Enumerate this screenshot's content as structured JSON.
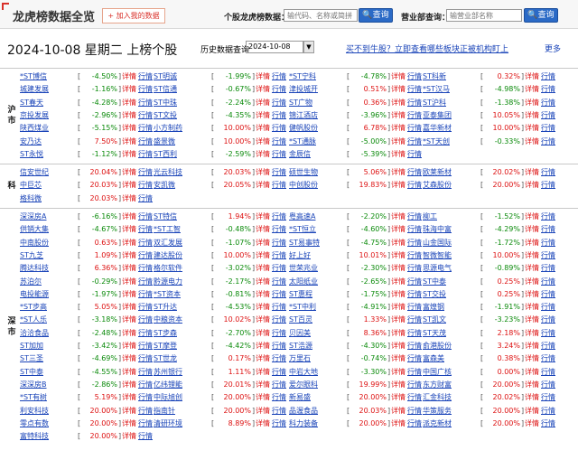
{
  "header": {
    "title": "龙虎榜数据全览",
    "fav_label": "+ 加入我的数据",
    "stock_label": "个股龙虎榜数据：",
    "stock_placeholder": "输代码、名称或简拼",
    "stock_button": "查询",
    "dept_label": "营业部查询：",
    "dept_placeholder": "输营业部名称",
    "dept_button": "查询"
  },
  "toolbar": {
    "date_title": "2024-10-08 星期二 上榜个股",
    "hist_label": "历史数据查询",
    "date_value": "2024-10-08",
    "promo_link": "买不到牛股？立即查看哪些板块正被机构盯上",
    "more_link": "更多"
  },
  "detail_label": "详情",
  "quote_label": "行情",
  "watermark": "",
  "sections": [
    {
      "label": "沪市",
      "rows": [
        [
          [
            "*ST博信",
            "-4.50%"
          ],
          [
            "ST明诚",
            "-1.99%"
          ],
          [
            "*ST宁科",
            "-4.78%"
          ],
          [
            "ST科新",
            "0.32%"
          ]
        ],
        [
          [
            "城建发展",
            "-1.16%"
          ],
          [
            "ST信通",
            "-0.67%"
          ],
          [
            "津投城开",
            "0.51%"
          ],
          [
            "*ST汉马",
            "-4.98%"
          ]
        ],
        [
          [
            "ST春天",
            "-4.28%"
          ],
          [
            "ST中珠",
            "-2.24%"
          ],
          [
            "ST广物",
            "0.36%"
          ],
          [
            "ST沪科",
            "-1.38%"
          ]
        ],
        [
          [
            "京投发展",
            "-2.96%"
          ],
          [
            "ST文投",
            "-4.35%"
          ],
          [
            "锦江酒店",
            "-3.96%"
          ],
          [
            "亚泰集团",
            "10.05%"
          ]
        ],
        [
          [
            "陕西煤业",
            "-5.15%"
          ],
          [
            "小方制药",
            "10.00%"
          ],
          [
            "健帆股份",
            "6.78%"
          ],
          [
            "嘉华新材",
            "10.00%"
          ]
        ],
        [
          [
            "安乃达",
            "7.50%"
          ],
          [
            "盛景微",
            "10.00%"
          ],
          [
            "*ST通脉",
            "-5.00%"
          ],
          [
            "*ST天创",
            "-0.33%"
          ]
        ],
        [
          [
            "ST永悦",
            "-1.12%"
          ],
          [
            "ST西利",
            "-2.59%"
          ],
          [
            "金辰信",
            "-5.39%"
          ],
          null
        ]
      ]
    },
    {
      "label": "科",
      "rows": [
        [
          [
            "信安世纪",
            "20.04%"
          ],
          [
            "光云科技",
            "20.03%"
          ],
          [
            "硕世生物",
            "5.06%"
          ],
          [
            "欧莱新材",
            "20.02%"
          ]
        ],
        [
          [
            "中巨芯",
            "20.03%"
          ],
          [
            "安凯微",
            "20.05%"
          ],
          [
            "中创股份",
            "19.83%"
          ],
          [
            "艾森股份",
            "20.00%"
          ]
        ],
        [
          [
            "格科微",
            "20.03%"
          ],
          null,
          null,
          null
        ]
      ]
    },
    {
      "label": "深市",
      "rows": [
        [
          [
            "深深房A",
            "-6.16%"
          ],
          [
            "ST特信",
            "1.94%"
          ],
          [
            "粤高速A",
            "-2.20%"
          ],
          [
            "柳工",
            "-1.52%"
          ]
        ],
        [
          [
            "供销大集",
            "-4.67%"
          ],
          [
            "*ST工智",
            "-0.48%"
          ],
          [
            "*ST恒立",
            "-4.60%"
          ],
          [
            "珠海中富",
            "-4.29%"
          ]
        ],
        [
          [
            "中南股份",
            "0.63%"
          ],
          [
            "双汇发展",
            "-1.07%"
          ],
          [
            "ST易事特",
            "-4.75%"
          ],
          [
            "山金国际",
            "-1.72%"
          ]
        ],
        [
          [
            "ST九芝",
            "1.09%"
          ],
          [
            "建达股份",
            "10.00%"
          ],
          [
            "好上好",
            "10.01%"
          ],
          [
            "智微智能",
            "10.00%"
          ]
        ],
        [
          [
            "腾达科技",
            "6.36%"
          ],
          [
            "格尔软件",
            "-3.02%"
          ],
          [
            "世荣兆业",
            "-2.30%"
          ],
          [
            "思源电气",
            "-0.89%"
          ]
        ],
        [
          [
            "苏泊尔",
            "-0.29%"
          ],
          [
            "黔源电力",
            "-2.17%"
          ],
          [
            "太阳纸业",
            "-2.65%"
          ],
          [
            "ST中泰",
            "0.25%"
          ]
        ],
        [
          [
            "电投能源",
            "-1.97%"
          ],
          [
            "*ST资本",
            "-0.81%"
          ],
          [
            "ST惠程",
            "-1.75%"
          ],
          [
            "ST交投",
            "0.25%"
          ]
        ],
        [
          [
            "*ST步高",
            "5.05%"
          ],
          [
            "ST升达",
            "-4.53%"
          ],
          [
            "*ST中利",
            "-4.91%"
          ],
          [
            "富煌钢",
            "-1.91%"
          ]
        ],
        [
          [
            "*ST人乐",
            "-3.18%"
          ],
          [
            "中粮资本",
            "10.02%"
          ],
          [
            "ST百灵",
            "1.33%"
          ],
          [
            "ST凯文",
            "-3.23%"
          ]
        ],
        [
          [
            "洽洽食品",
            "-2.48%"
          ],
          [
            "ST步森",
            "-2.70%"
          ],
          [
            "贝因美",
            "8.36%"
          ],
          [
            "ST天茂",
            "2.18%"
          ]
        ],
        [
          [
            "ST加加",
            "-3.42%"
          ],
          [
            "ST摩登",
            "-4.42%"
          ],
          [
            "ST浩源",
            "-4.30%"
          ],
          [
            "俞港股份",
            "3.24%"
          ]
        ],
        [
          [
            "ST三圣",
            "-4.69%"
          ],
          [
            "ST世龙",
            "0.17%"
          ],
          [
            "万里石",
            "-0.74%"
          ],
          [
            "富森美",
            "0.38%"
          ]
        ],
        [
          [
            "ST中泰",
            "-4.55%"
          ],
          [
            "苏州银行",
            "1.11%"
          ],
          [
            "中岩大地",
            "-3.30%"
          ],
          [
            "中国广核",
            "0.00%"
          ]
        ],
        [
          [
            "深深房B",
            "-2.86%"
          ],
          [
            "亿纬锂能",
            "20.01%"
          ],
          [
            "爱尔眼科",
            "19.99%"
          ],
          [
            "东方财富",
            "20.00%"
          ]
        ],
        [
          [
            "*ST有树",
            "5.19%"
          ],
          [
            "中际旭创",
            "20.00%"
          ],
          [
            "新易盛",
            "20.00%"
          ],
          [
            "汇金科技",
            "20.02%"
          ]
        ],
        [
          [
            "利安科技",
            "20.00%"
          ],
          [
            "指南针",
            "20.00%"
          ],
          [
            "品渥食品",
            "20.03%"
          ],
          [
            "华策服务",
            "20.00%"
          ]
        ],
        [
          [
            "零点有数",
            "20.00%"
          ],
          [
            "清研环境",
            "8.89%"
          ],
          [
            "科力装备",
            "20.00%"
          ],
          [
            "派克新材",
            "20.00%"
          ]
        ],
        [
          [
            "富特科技",
            "20.00%"
          ],
          null,
          null,
          null
        ]
      ]
    }
  ]
}
